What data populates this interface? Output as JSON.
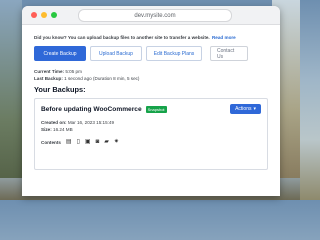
{
  "browser": {
    "url": "dev.mysite.com"
  },
  "notice": {
    "text": "Did you know? You can upload backup files to another site to transfer a website.",
    "link": "Read more"
  },
  "tabs": [
    {
      "label": "Create Backup"
    },
    {
      "label": "Upload Backup"
    },
    {
      "label": "Edit Backup Plans"
    },
    {
      "label": "Contact Us"
    }
  ],
  "status": {
    "current_time_label": "Current Time:",
    "current_time_value": "5:05 pm",
    "last_backup_label": "Last Backup:",
    "last_backup_value": "1 second ago (Duration 8 min, 5 sec)"
  },
  "backups": {
    "title": "Your Backups:",
    "items": [
      {
        "name": "Before updating WooCommerce",
        "badge": "Snapshot",
        "actions_label": "Actions",
        "created_label": "Created on:",
        "created_value": "Mar 16, 2023 15:15:49",
        "size_label": "Size:",
        "size_value": "16.24 MB",
        "contents_label": "Contents",
        "content_icons": [
          "database-icon",
          "file-icon",
          "plugins-icon",
          "themes-icon",
          "folder-icon",
          "settings-icon"
        ]
      }
    ]
  },
  "colors": {
    "primary": "#2f68d8",
    "badge": "#16a34a"
  }
}
